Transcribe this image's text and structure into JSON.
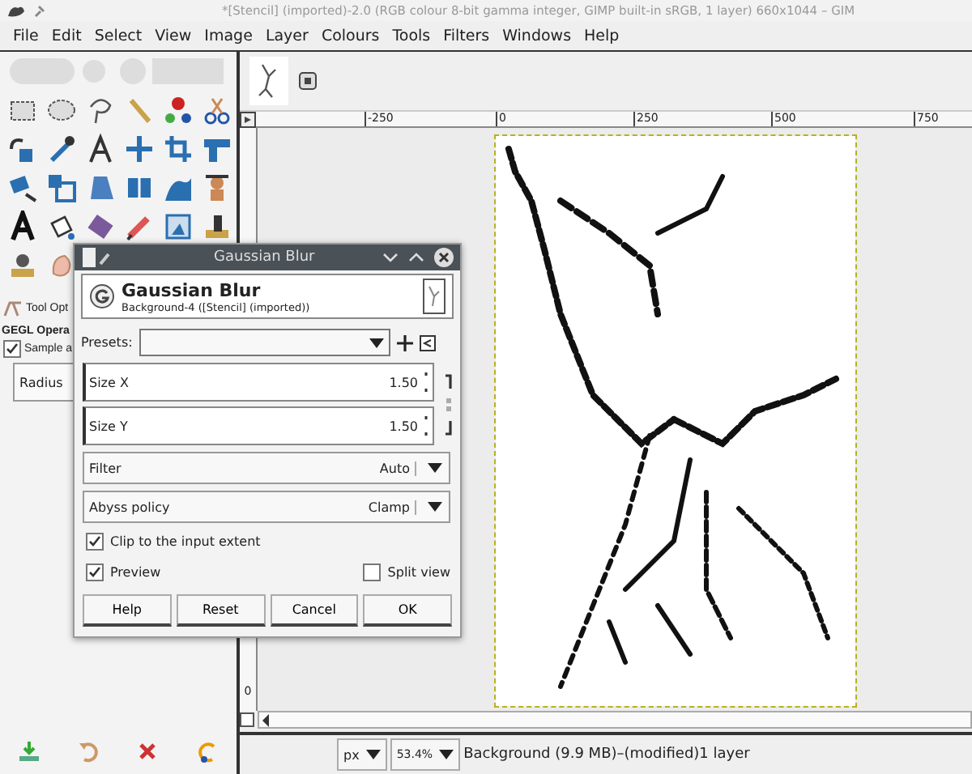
{
  "window": {
    "title": "*[Stencil] (imported)-2.0 (RGB colour 8-bit gamma integer, GIMP built-in sRGB, 1 layer) 660x1044 – GIM"
  },
  "menu": [
    "File",
    "Edit",
    "Select",
    "View",
    "Image",
    "Layer",
    "Colours",
    "Tools",
    "Filters",
    "Windows",
    "Help"
  ],
  "tool_options": {
    "title": "Tool Opt",
    "section": "GEGL Opera",
    "sample": {
      "label": "Sample a",
      "checked": true
    },
    "radius_label": "Radius"
  },
  "rulers": {
    "horizontal": [
      "-250",
      "0",
      "250",
      "500",
      "750"
    ],
    "vertical": [
      "0"
    ]
  },
  "status_bar": {
    "unit": "px",
    "zoom": "53.4%",
    "message": "Background (9.9 MB)–(modified)1 layer"
  },
  "dialog": {
    "title": "Gaussian Blur",
    "heading": "Gaussian Blur",
    "subtitle": "Background-4 ([Stencil] (imported))",
    "presets_label": "Presets:",
    "sizes": [
      {
        "label": "Size X",
        "value": "1.50"
      },
      {
        "label": "Size Y",
        "value": "1.50"
      }
    ],
    "combos": [
      {
        "label": "Filter",
        "value": "Auto"
      },
      {
        "label": "Abyss policy",
        "value": "Clamp"
      }
    ],
    "clip": {
      "label": "Clip to the input extent",
      "checked": true
    },
    "preview": {
      "label": "Preview",
      "checked": true
    },
    "split_view": {
      "label": "Split view",
      "checked": false
    },
    "buttons": [
      "Help",
      "Reset",
      "Cancel",
      "OK"
    ]
  }
}
